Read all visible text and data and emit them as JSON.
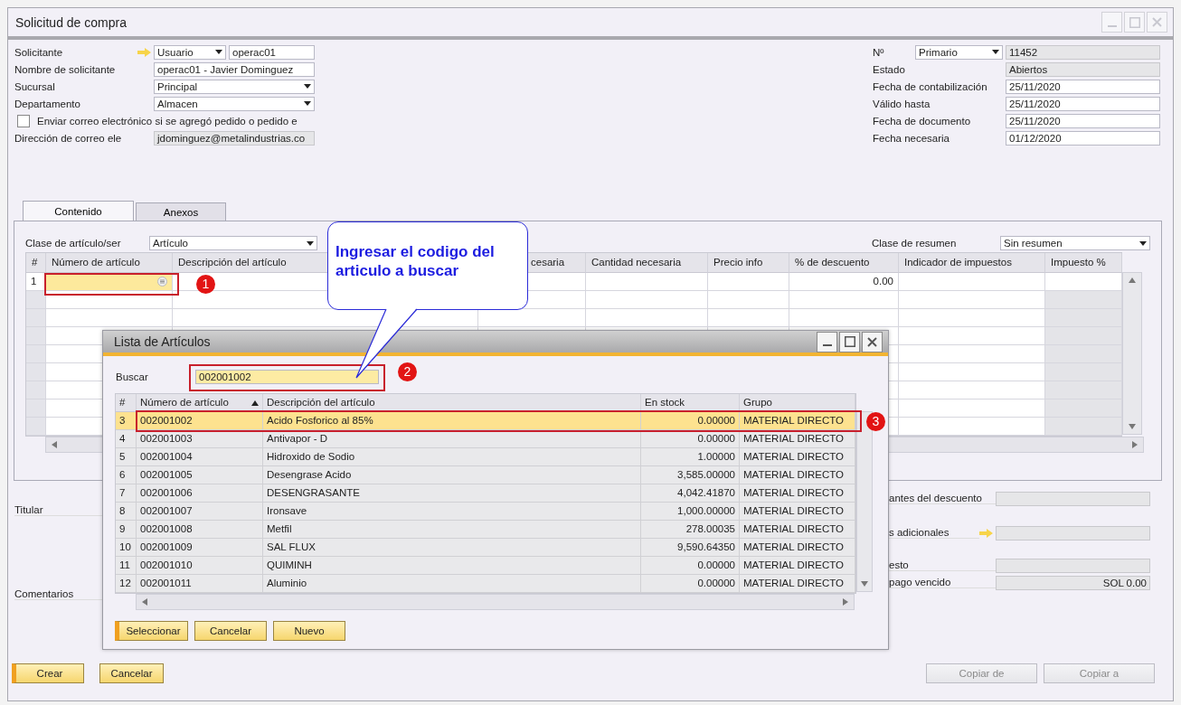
{
  "window": {
    "title": "Solicitud de compra"
  },
  "header_left": [
    {
      "kind": "combo_text",
      "label": "Solicitante",
      "link": true,
      "combo": "Usuario",
      "value": "operac01"
    },
    {
      "kind": "text",
      "label": "Nombre de solicitante",
      "value": "operac01 - Javier Dominguez"
    },
    {
      "kind": "combo",
      "label": "Sucursal",
      "value": "Principal"
    },
    {
      "kind": "combo",
      "label": "Departamento",
      "value": "Almacen"
    },
    {
      "kind": "checkbox",
      "label": "Enviar correo electrónico si se agregó pedido o pedido e",
      "checked": false
    },
    {
      "kind": "text",
      "label": "Dirección de correo ele",
      "value": "jdominguez@metalindustrias.co",
      "readonly": true
    }
  ],
  "header_right": [
    {
      "kind": "combo_text",
      "label": "Nº",
      "combo": "Primario",
      "value": "11452",
      "readonly": true
    },
    {
      "kind": "text",
      "label": "Estado",
      "value": "Abiertos",
      "readonly": true
    },
    {
      "kind": "text",
      "label": "Fecha de contabilización",
      "value": "25/11/2020"
    },
    {
      "kind": "text",
      "label": "Válido hasta",
      "value": "25/11/2020"
    },
    {
      "kind": "text",
      "label": "Fecha de documento",
      "value": "25/11/2020"
    },
    {
      "kind": "text",
      "label": "Fecha necesaria",
      "value": "01/12/2020"
    }
  ],
  "tabs": [
    {
      "label": "Contenido",
      "selected": true
    },
    {
      "label": "Anexos",
      "selected": false
    }
  ],
  "item_class": {
    "label": "Clase de artículo/ser",
    "value": "Artículo"
  },
  "summary_class": {
    "label": "Clase de resumen",
    "value": "Sin resumen"
  },
  "grid": {
    "columns": [
      "#",
      "Número de artículo",
      "Descripción del artículo",
      "cesaria",
      "Cantidad necesaria",
      "Precio info",
      "% de descuento",
      "Indicador de impuestos",
      "Impuesto %"
    ],
    "rows": [
      {
        "number": "1",
        "discount": "0.00"
      }
    ]
  },
  "footer_left": [
    "Titular",
    "Comentarios"
  ],
  "footer_right": [
    {
      "label": "antes del descuento"
    },
    {
      "label": "s adicionales",
      "link": true
    },
    {
      "label": "esto"
    },
    {
      "label": "pago vencido",
      "value": "SOL 0.00"
    }
  ],
  "buttons": [
    {
      "label": "Crear",
      "primary": true,
      "disabled": false
    },
    {
      "label": "Cancelar",
      "primary": false,
      "disabled": false
    }
  ],
  "right_buttons": [
    {
      "label": "Copiar de",
      "primary": false,
      "disabled": true
    },
    {
      "label": "Copiar a",
      "primary": false,
      "disabled": true
    }
  ],
  "dialog": {
    "title": "Lista de Artículos",
    "search": {
      "label": "Buscar",
      "value": "002001002"
    },
    "columns": [
      {
        "label": "#",
        "sorted": false
      },
      {
        "label": "Número de artículo",
        "sorted": true
      },
      {
        "label": "Descripción del artículo",
        "sorted": false
      },
      {
        "label": "En stock",
        "sorted": false
      },
      {
        "label": "Grupo",
        "sorted": false
      }
    ],
    "rows": [
      {
        "number": "3",
        "code": "002001002",
        "description": "Acido Fosforico al 85%",
        "stock": "0.00000",
        "group": "MATERIAL DIRECTO",
        "selected": true
      },
      {
        "number": "4",
        "code": "002001003",
        "description": "Antivapor - D",
        "stock": "0.00000",
        "group": "MATERIAL DIRECTO",
        "selected": false
      },
      {
        "number": "5",
        "code": "002001004",
        "description": "Hidroxido de Sodio",
        "stock": "1.00000",
        "group": "MATERIAL DIRECTO",
        "selected": false
      },
      {
        "number": "6",
        "code": "002001005",
        "description": "Desengrase Acido",
        "stock": "3,585.00000",
        "group": "MATERIAL DIRECTO",
        "selected": false
      },
      {
        "number": "7",
        "code": "002001006",
        "description": "DESENGRASANTE",
        "stock": "4,042.41870",
        "group": "MATERIAL DIRECTO",
        "selected": false
      },
      {
        "number": "8",
        "code": "002001007",
        "description": "Ironsave",
        "stock": "1,000.00000",
        "group": "MATERIAL DIRECTO",
        "selected": false
      },
      {
        "number": "9",
        "code": "002001008",
        "description": "Metfil",
        "stock": "278.00035",
        "group": "MATERIAL DIRECTO",
        "selected": false
      },
      {
        "number": "10",
        "code": "002001009",
        "description": "SAL FLUX",
        "stock": "9,590.64350",
        "group": "MATERIAL DIRECTO",
        "selected": false
      },
      {
        "number": "11",
        "code": "002001010",
        "description": "QUIMINH",
        "stock": "0.00000",
        "group": "MATERIAL DIRECTO",
        "selected": false
      },
      {
        "number": "12",
        "code": "002001011",
        "description": "Aluminio",
        "stock": "0.00000",
        "group": "MATERIAL DIRECTO",
        "selected": false
      }
    ],
    "buttons": [
      {
        "label": "Seleccionar",
        "primary": true
      },
      {
        "label": "Cancelar",
        "primary": false
      },
      {
        "label": "Nuevo",
        "primary": false
      }
    ]
  },
  "callout": {
    "text": "Ingresar el codigo del articulo a buscar"
  },
  "steps": [
    "1",
    "2",
    "3"
  ]
}
